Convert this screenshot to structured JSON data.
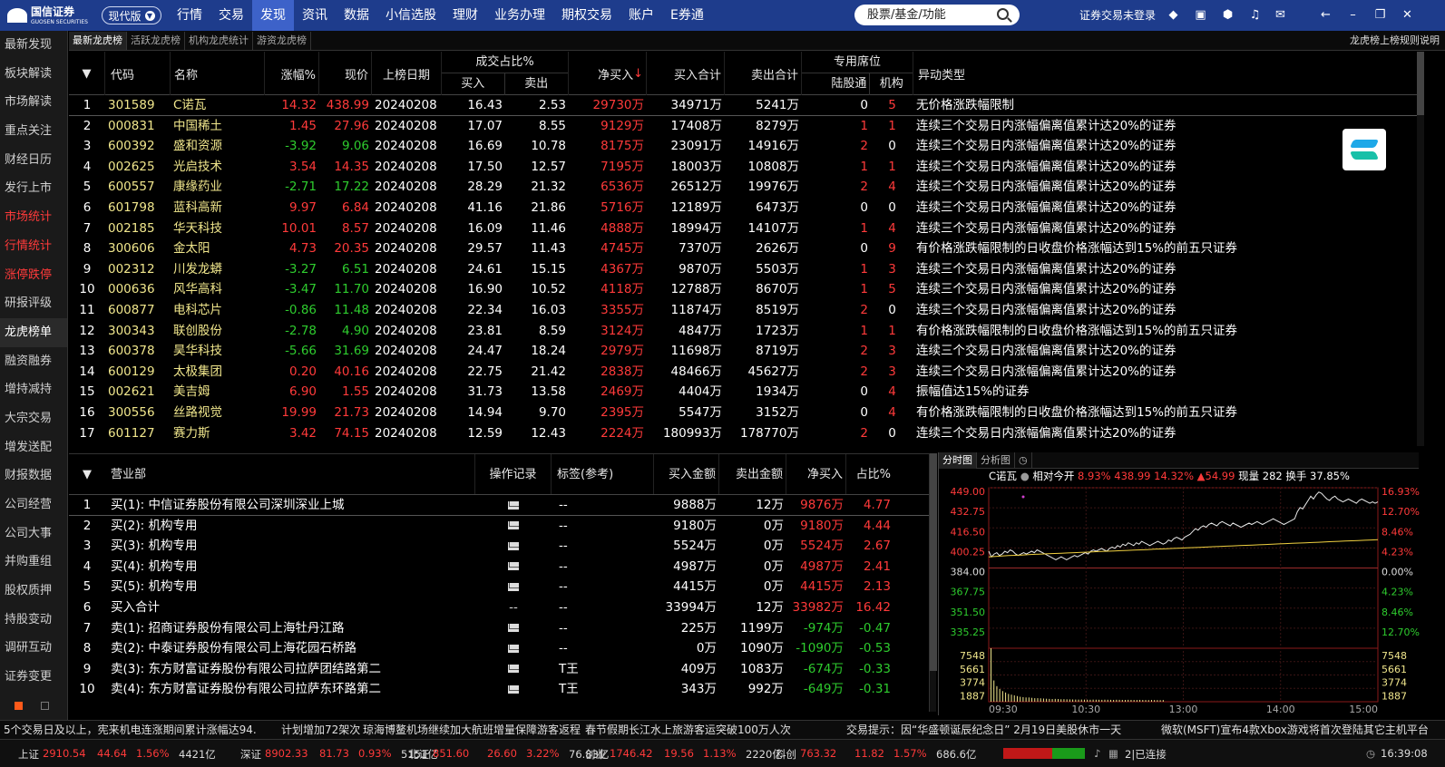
{
  "app": {
    "logo_text": "国信证券",
    "logo_sub": "GUOSEN SECURITIES",
    "version": "现代版"
  },
  "nav": [
    "行情",
    "交易",
    "发现",
    "资讯",
    "数据",
    "小信选股",
    "理财",
    "业务办理",
    "期权交易",
    "账户",
    "E券通"
  ],
  "nav_active": 2,
  "search": {
    "placeholder": "股票/基金/功能"
  },
  "login_text": "证券交易未登录",
  "sidebar": [
    {
      "label": "最新发现",
      "style": ""
    },
    {
      "label": "板块解读",
      "style": ""
    },
    {
      "label": "市场解读",
      "style": ""
    },
    {
      "label": "重点关注",
      "style": ""
    },
    {
      "label": "财经日历",
      "style": ""
    },
    {
      "label": "发行上市",
      "style": ""
    },
    {
      "label": "市场统计",
      "style": "redt"
    },
    {
      "label": "行情统计",
      "style": "redt"
    },
    {
      "label": "涨停跌停",
      "style": "redt"
    },
    {
      "label": "研报评级",
      "style": ""
    },
    {
      "label": "龙虎榜单",
      "style": "active"
    },
    {
      "label": "融资融券",
      "style": ""
    },
    {
      "label": "增持减持",
      "style": ""
    },
    {
      "label": "大宗交易",
      "style": ""
    },
    {
      "label": "增发送配",
      "style": ""
    },
    {
      "label": "财报数据",
      "style": ""
    },
    {
      "label": "公司经营",
      "style": ""
    },
    {
      "label": "公司大事",
      "style": ""
    },
    {
      "label": "并购重组",
      "style": ""
    },
    {
      "label": "股权质押",
      "style": ""
    },
    {
      "label": "持股变动",
      "style": ""
    },
    {
      "label": "调研互动",
      "style": ""
    },
    {
      "label": "证券变更",
      "style": ""
    }
  ],
  "subtabs": [
    "最新龙虎榜",
    "活跃龙虎榜",
    "机构龙虎统计",
    "游资龙虎榜"
  ],
  "rule_link": "龙虎榜上榜规则说明",
  "main_table": {
    "headers": {
      "code": "代码",
      "name": "名称",
      "pct": "涨幅%",
      "price": "现价",
      "date": "上榜日期",
      "ratio": "成交占比%",
      "ratio_buy": "买入",
      "ratio_sell": "卖出",
      "net": "净买入",
      "buy_total": "买入合计",
      "sell_total": "卖出合计",
      "seat": "专用席位",
      "seat_hk": "陆股通",
      "seat_inst": "机构",
      "type": "异动类型"
    },
    "rows": [
      [
        "1",
        "301589",
        "C诺瓦",
        "14.32",
        "438.99",
        "20240208",
        "16.43",
        "2.53",
        "29730万",
        "34971万",
        "5241万",
        "0",
        "5",
        "无价格涨跌幅限制"
      ],
      [
        "2",
        "000831",
        "中国稀土",
        "1.45",
        "27.96",
        "20240208",
        "17.07",
        "8.55",
        "9129万",
        "17408万",
        "8279万",
        "1",
        "1",
        "连续三个交易日内涨幅偏离值累计达20%的证券"
      ],
      [
        "3",
        "600392",
        "盛和资源",
        "-3.92",
        "9.06",
        "20240208",
        "16.69",
        "10.78",
        "8175万",
        "23091万",
        "14916万",
        "2",
        "0",
        "连续三个交易日内涨幅偏离值累计达20%的证券"
      ],
      [
        "4",
        "002625",
        "光启技术",
        "3.54",
        "14.35",
        "20240208",
        "17.50",
        "12.57",
        "7195万",
        "18003万",
        "10808万",
        "1",
        "1",
        "连续三个交易日内涨幅偏离值累计达20%的证券"
      ],
      [
        "5",
        "600557",
        "康缘药业",
        "-2.71",
        "17.22",
        "20240208",
        "28.29",
        "21.32",
        "6536万",
        "26512万",
        "19976万",
        "2",
        "4",
        "连续三个交易日内涨幅偏离值累计达20%的证券"
      ],
      [
        "6",
        "601798",
        "蓝科高新",
        "9.97",
        "6.84",
        "20240208",
        "41.16",
        "21.86",
        "5716万",
        "12189万",
        "6473万",
        "0",
        "0",
        "连续三个交易日内涨幅偏离值累计达20%的证券"
      ],
      [
        "7",
        "002185",
        "华天科技",
        "10.01",
        "8.57",
        "20240208",
        "16.09",
        "11.46",
        "4888万",
        "18994万",
        "14107万",
        "1",
        "4",
        "连续三个交易日内涨幅偏离值累计达20%的证券"
      ],
      [
        "8",
        "300606",
        "金太阳",
        "4.73",
        "20.35",
        "20240208",
        "29.57",
        "11.43",
        "4745万",
        "7370万",
        "2626万",
        "0",
        "9",
        "有价格涨跌幅限制的日收盘价格涨幅达到15%的前五只证券"
      ],
      [
        "9",
        "002312",
        "川发龙蟒",
        "-3.27",
        "6.51",
        "20240208",
        "24.61",
        "15.15",
        "4367万",
        "9870万",
        "5503万",
        "1",
        "3",
        "连续三个交易日内涨幅偏离值累计达20%的证券"
      ],
      [
        "10",
        "000636",
        "风华高科",
        "-3.47",
        "11.70",
        "20240208",
        "16.90",
        "10.52",
        "4118万",
        "12788万",
        "8670万",
        "1",
        "5",
        "连续三个交易日内涨幅偏离值累计达20%的证券"
      ],
      [
        "11",
        "600877",
        "电科芯片",
        "-0.86",
        "11.48",
        "20240208",
        "22.34",
        "16.03",
        "3355万",
        "11874万",
        "8519万",
        "2",
        "0",
        "连续三个交易日内涨幅偏离值累计达20%的证券"
      ],
      [
        "12",
        "300343",
        "联创股份",
        "-2.78",
        "4.90",
        "20240208",
        "23.81",
        "8.59",
        "3124万",
        "4847万",
        "1723万",
        "1",
        "1",
        "有价格涨跌幅限制的日收盘价格涨幅达到15%的前五只证券"
      ],
      [
        "13",
        "600378",
        "昊华科技",
        "-5.66",
        "31.69",
        "20240208",
        "24.47",
        "18.24",
        "2979万",
        "11698万",
        "8719万",
        "2",
        "3",
        "连续三个交易日内涨幅偏离值累计达20%的证券"
      ],
      [
        "14",
        "600129",
        "太极集团",
        "0.20",
        "40.16",
        "20240208",
        "22.75",
        "21.42",
        "2838万",
        "48466万",
        "45627万",
        "2",
        "3",
        "连续三个交易日内涨幅偏离值累计达20%的证券"
      ],
      [
        "15",
        "002621",
        "美吉姆",
        "6.90",
        "1.55",
        "20240208",
        "31.73",
        "13.58",
        "2469万",
        "4404万",
        "1934万",
        "0",
        "4",
        "振幅值达15%的证券"
      ],
      [
        "16",
        "300556",
        "丝路视觉",
        "19.99",
        "21.73",
        "20240208",
        "14.94",
        "9.70",
        "2395万",
        "5547万",
        "3152万",
        "0",
        "4",
        "有价格涨跌幅限制的日收盘价格涨幅达到15%的前五只证券"
      ],
      [
        "17",
        "601127",
        "赛力斯",
        "3.42",
        "74.15",
        "20240208",
        "12.59",
        "12.43",
        "2224万",
        "180993万",
        "178770万",
        "2",
        "0",
        "连续三个交易日内涨幅偏离值累计达20%的证券"
      ]
    ]
  },
  "seat_table": {
    "headers": {
      "dept": "营业部",
      "record": "操作记录",
      "tag": "标签(参考)",
      "buy": "买入金额",
      "sell": "卖出金额",
      "net": "净买入",
      "ratio": "占比%"
    },
    "rows": [
      [
        "1",
        "买(1): 中信证券股份有限公司深圳深业上城",
        "mail",
        "--",
        "9888万",
        "12万",
        "9876万",
        "4.77"
      ],
      [
        "2",
        "买(2): 机构专用",
        "mail",
        "--",
        "9180万",
        "0万",
        "9180万",
        "4.44"
      ],
      [
        "3",
        "买(3): 机构专用",
        "mail",
        "--",
        "5524万",
        "0万",
        "5524万",
        "2.67"
      ],
      [
        "4",
        "买(4): 机构专用",
        "mail",
        "--",
        "4987万",
        "0万",
        "4987万",
        "2.41"
      ],
      [
        "5",
        "买(5): 机构专用",
        "mail",
        "--",
        "4415万",
        "0万",
        "4415万",
        "2.13"
      ],
      [
        "6",
        "买入合计",
        "--",
        "--",
        "33994万",
        "12万",
        "33982万",
        "16.42"
      ],
      [
        "7",
        "卖(1): 招商证券股份有限公司上海牡丹江路",
        "mail",
        "--",
        "225万",
        "1199万",
        "-974万",
        "-0.47"
      ],
      [
        "8",
        "卖(2): 中泰证券股份有限公司上海花园石桥路",
        "mail",
        "--",
        "0万",
        "1090万",
        "-1090万",
        "-0.53"
      ],
      [
        "9",
        "卖(3): 东方财富证券股份有限公司拉萨团结路第二",
        "mail",
        "T王",
        "409万",
        "1083万",
        "-674万",
        "-0.33"
      ],
      [
        "10",
        "卖(4): 东方财富证券股份有限公司拉萨东环路第二",
        "mail",
        "T王",
        "343万",
        "992万",
        "-649万",
        "-0.31"
      ]
    ]
  },
  "chart_tabs": [
    "分时图",
    "分析图"
  ],
  "chart_info": {
    "name": "C诺瓦",
    "label1": "相对今开",
    "v1": "8.93%",
    "v2": "438.99",
    "v3": "14.32%",
    "v4": "▲54.99",
    "label2": "现量",
    "v5": "282",
    "label3": "换手",
    "v6": "37.85%"
  },
  "chart_data": {
    "type": "line",
    "title": "",
    "price_ticks": [
      "449.00",
      "432.75",
      "416.50",
      "400.25",
      "384.00",
      "367.75",
      "351.50",
      "335.25"
    ],
    "pct_ticks": [
      "16.93%",
      "12.70%",
      "8.46%",
      "4.23%",
      "0.00%",
      "4.23%",
      "8.46%",
      "12.70%"
    ],
    "vol_ticks": [
      "7548",
      "5661",
      "3774",
      "1887"
    ],
    "time_ticks": [
      "09:30",
      "10:30",
      "13:00",
      "14:00",
      "15:00"
    ],
    "ylim": [
      335.25,
      449.0
    ],
    "price": [
      404,
      400,
      402,
      403,
      401,
      402,
      404,
      403,
      405,
      404,
      402,
      401,
      402,
      403,
      402,
      403,
      404,
      403,
      405,
      404,
      403,
      402,
      401,
      400,
      399,
      398,
      399,
      400,
      399,
      398,
      399,
      400,
      401,
      400,
      401,
      402,
      403,
      402,
      404,
      405,
      404,
      405,
      406,
      405,
      404,
      406,
      407,
      406,
      408,
      407,
      409,
      408,
      410,
      409,
      408,
      410,
      409,
      411,
      410,
      409,
      408,
      409,
      410,
      411,
      410,
      409,
      410,
      412,
      411,
      413,
      414,
      413,
      412,
      414,
      415,
      416,
      418,
      420,
      419,
      421,
      422,
      421,
      423,
      424,
      423,
      422,
      424,
      425,
      424,
      423,
      422,
      424,
      423,
      422,
      421,
      422,
      423,
      424,
      423,
      424,
      425,
      424,
      423,
      424,
      425,
      426,
      427,
      426,
      425,
      424,
      423,
      424,
      425,
      426,
      427,
      432,
      435,
      434,
      437,
      440,
      443,
      441,
      444,
      446,
      445,
      443,
      441,
      440,
      442,
      443,
      441,
      440,
      439,
      440,
      441,
      440,
      439,
      438,
      440,
      441,
      440,
      439,
      438,
      439,
      438,
      439
    ],
    "avg": [
      400,
      400.3,
      400.6,
      400.9,
      401.1,
      401.3,
      401.6,
      401.8,
      402,
      402.2,
      402.4,
      402.6,
      402.8,
      403,
      403.2,
      403.4,
      403.6,
      403.8,
      404,
      404.2,
      404.4,
      404.6,
      404.8,
      405,
      405.2,
      405.4,
      405.6,
      405.8,
      406,
      406.2,
      406.4,
      406.6,
      406.8,
      407,
      407.2,
      407.4,
      407.6,
      407.8,
      408,
      408.2,
      408.4,
      408.6,
      408.8,
      409,
      409.2,
      409.4,
      409.6,
      409.8,
      410,
      410.2,
      410.4,
      410.6,
      410.8,
      411,
      411.2,
      411.4,
      411.6,
      411.8,
      412,
      412.2
    ],
    "volume": [
      7548,
      3000,
      2200,
      1800,
      1500,
      1300,
      1100,
      1000,
      900,
      800,
      700,
      650,
      600,
      600,
      550,
      500,
      500,
      480,
      450,
      420,
      400,
      380,
      400,
      380,
      350,
      360,
      340,
      330,
      320,
      310,
      300,
      310,
      300,
      290,
      280,
      300,
      290,
      280,
      270,
      290,
      280,
      270,
      260,
      280,
      270,
      260,
      250,
      270,
      260,
      250,
      240,
      260,
      250,
      240,
      230,
      250,
      240,
      230,
      220,
      240
    ]
  },
  "news": [
    {
      "text": "5个交易日及以上，宪来机电连涨期间累计涨幅达94.",
      "color": "white"
    },
    {
      "text": "计划增加72架次",
      "color": "white"
    },
    {
      "text": "琼海博鳌机场继续加大航班增量保障游客返程",
      "color": "white"
    },
    {
      "text": "春节假期长江水上旅游客运突破100万人次",
      "color": "white"
    },
    {
      "text": "交易提示：因“华盛顿诞辰纪念日”  2月19日美股休市一天",
      "color": "white"
    },
    {
      "text": "微软(MSFT)宣布4款Xbox游戏将首次登陆其它主机平台",
      "color": "white"
    }
  ],
  "status": {
    "sh": [
      "上证",
      "2910.54",
      "44.64",
      "1.56%",
      "4421亿"
    ],
    "sz": [
      "深证",
      "8902.33",
      "81.73",
      "0.93%",
      "5151亿"
    ],
    "bj": [
      "北证",
      "851.60",
      "26.60",
      "3.22%",
      "76.83亿"
    ],
    "cy": [
      "创业",
      "1746.42",
      "19.56",
      "1.13%",
      "2220亿"
    ],
    "kc": [
      "科创",
      "763.32",
      "11.82",
      "1.57%",
      "686.6亿"
    ],
    "conn": "2|已连接",
    "time": "16:39:08"
  }
}
